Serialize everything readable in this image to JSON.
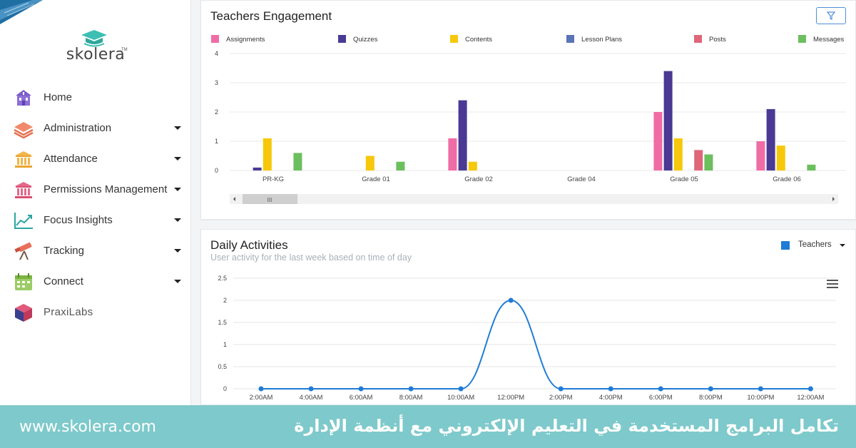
{
  "sidebar": {
    "brand": "skolera",
    "brand_mark": "TM",
    "items": [
      {
        "label": "Home",
        "icon": "school-building-icon",
        "has_dropdown": false
      },
      {
        "label": "Administration",
        "icon": "layers-icon",
        "has_dropdown": true
      },
      {
        "label": "Attendance",
        "icon": "institution-icon",
        "has_dropdown": true
      },
      {
        "label": "Permissions Management",
        "icon": "institution-icon",
        "has_dropdown": true
      },
      {
        "label": "Focus Insights",
        "icon": "trend-chart-icon",
        "has_dropdown": true
      },
      {
        "label": "Tracking",
        "icon": "telescope-icon",
        "has_dropdown": true
      },
      {
        "label": "Connect",
        "icon": "calendar-icon",
        "has_dropdown": true
      }
    ],
    "praxi": {
      "label": "PraxiLabs",
      "icon": "cube-icon"
    }
  },
  "engagement": {
    "title": "Teachers Engagement",
    "filter_icon": "filter-icon",
    "scroll_thumb": "III",
    "chart_data": {
      "type": "bar",
      "categories": [
        "PR-KG",
        "Grade 01",
        "Grade 02",
        "Grade 04",
        "Grade 05",
        "Grade 06"
      ],
      "ylim": [
        0,
        4
      ],
      "yticks": [
        "0",
        "1",
        "2",
        "3",
        "4"
      ],
      "legend_position": "top",
      "series": [
        {
          "name": "Assignments",
          "color": "#f06ca4",
          "values": [
            0,
            0,
            1.1,
            0,
            2.0,
            1.0
          ]
        },
        {
          "name": "Quizzes",
          "color": "#4a3a94",
          "values": [
            0.1,
            0,
            2.4,
            0,
            3.4,
            2.1
          ]
        },
        {
          "name": "Contents",
          "color": "#f7c80a",
          "values": [
            1.1,
            0.5,
            0.3,
            0,
            1.1,
            0.85
          ]
        },
        {
          "name": "Lesson Plans",
          "color": "#5b74b8",
          "values": [
            0,
            0,
            0,
            0,
            0,
            0
          ]
        },
        {
          "name": "Posts",
          "color": "#e0667a",
          "values": [
            0,
            0,
            0,
            0,
            0.7,
            0
          ]
        },
        {
          "name": "Messages",
          "color": "#6cbf5e",
          "values": [
            0.6,
            0.3,
            0,
            0,
            0.55,
            0.2
          ]
        }
      ]
    }
  },
  "daily": {
    "title": "Daily Activities",
    "subtitle": "User activity for the last week based on time of day",
    "dropdown_label": "Teachers",
    "dropdown_color": "#1f7bd6",
    "menu_icon": "hamburger-menu-icon",
    "chart_data": {
      "type": "line",
      "x": [
        "2:00AM",
        "4:00AM",
        "6:00AM",
        "8:00AM",
        "10:00AM",
        "12:00PM",
        "2:00PM",
        "4:00PM",
        "6:00PM",
        "8:00PM",
        "10:00PM",
        "12:00AM"
      ],
      "ylim": [
        0,
        2.5
      ],
      "yticks": [
        "0",
        "0.5",
        "1",
        "1.5",
        "2",
        "2.5"
      ],
      "series": [
        {
          "name": "Teachers",
          "color": "#1f7bd6",
          "values": [
            0,
            0,
            0,
            0,
            0,
            2,
            0,
            0,
            0,
            0,
            0,
            0
          ]
        }
      ]
    }
  },
  "footer": {
    "url": "www.skolera.com",
    "arabic_title": "تكامل البرامج المستخدمة في التعليم الإلكتروني مع أنظمة الإدارة"
  }
}
